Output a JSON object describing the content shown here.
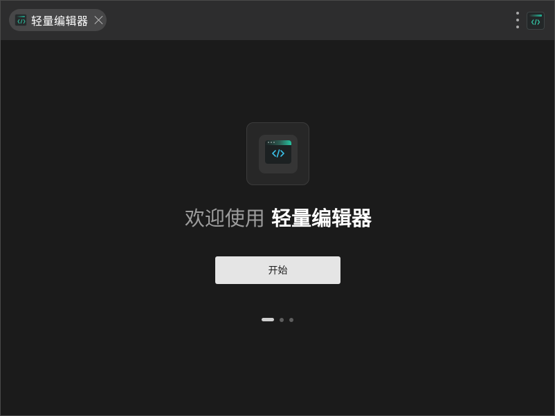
{
  "tab": {
    "title": "轻量编辑器",
    "icon": "code-editor-icon",
    "close_icon": "close-icon"
  },
  "titlebar": {
    "menu_icon": "more-vertical-icon",
    "app_icon": "code-editor-icon"
  },
  "welcome": {
    "prefix": "欢迎使用",
    "app_name": "轻量编辑器"
  },
  "start_button": {
    "label": "开始"
  },
  "pager": {
    "total_pages": 3,
    "current_page": 1
  },
  "colors": {
    "background": "#1b1b1b",
    "titlebar": "#2d2d2e",
    "accent": "#25c3a0",
    "button": "#e5e5e5"
  }
}
